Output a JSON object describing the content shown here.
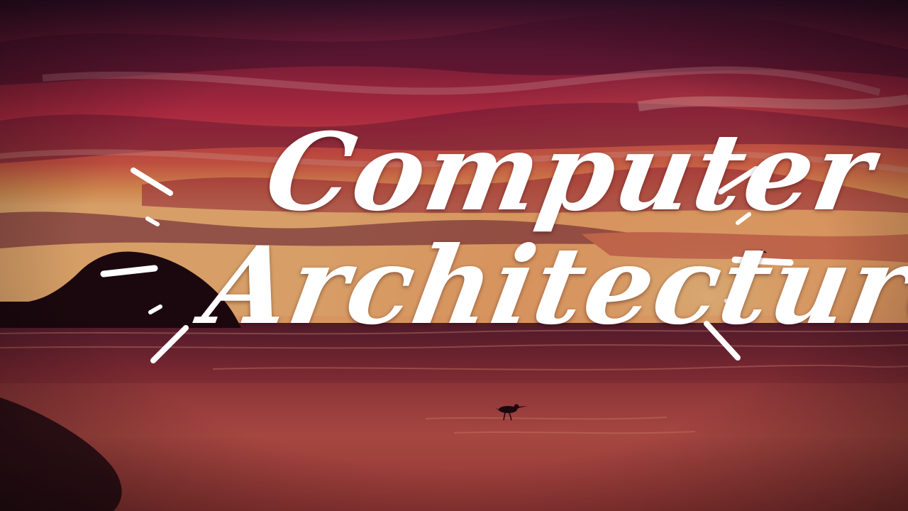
{
  "title": {
    "line1": "Computer",
    "line2": "Architecture"
  },
  "colors": {
    "sky_top": "#3a1430",
    "sky_red": "#c8324a",
    "sky_orange": "#f08a4a",
    "horizon_glow": "#ffc27a",
    "sea": "#7a2a38",
    "sand": "#c0524a",
    "silhouette": "#1a0a0e",
    "text": "#ffffff"
  },
  "decorations": [
    "spark-lines-left",
    "spark-lines-right"
  ],
  "silhouettes": [
    "rock-island",
    "shorebird"
  ]
}
